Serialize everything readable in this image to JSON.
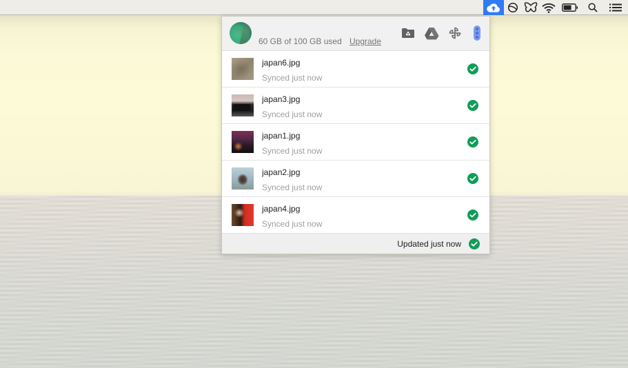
{
  "menubar": {
    "tray_icons": [
      {
        "icon": "google-drive-backup-icon",
        "active": true
      },
      {
        "icon": "circle-slash-icon"
      },
      {
        "icon": "butterfly-icon"
      },
      {
        "icon": "wifi-icon"
      },
      {
        "icon": "battery-icon"
      },
      {
        "icon": "spotlight-search-icon"
      },
      {
        "icon": "notification-center-icon"
      }
    ]
  },
  "panel": {
    "header": {
      "storage_text": "60 GB of 100 GB used",
      "storage_used_gb": 60,
      "storage_total_gb": 100,
      "upgrade_label": "Upgrade",
      "icons": [
        "drive-folder-icon",
        "google-drive-icon",
        "google-photos-icon",
        "more-vert-icon"
      ]
    },
    "files": [
      {
        "name": "japan6.jpg",
        "status": "Synced just now"
      },
      {
        "name": "japan3.jpg",
        "status": "Synced just now"
      },
      {
        "name": "japan1.jpg",
        "status": "Synced just now"
      },
      {
        "name": "japan2.jpg",
        "status": "Synced just now"
      },
      {
        "name": "japan4.jpg",
        "status": "Synced just now"
      }
    ],
    "footer": {
      "status_text": "Updated just now"
    }
  },
  "colors": {
    "accent_blue": "#2f7cf6",
    "success_green": "#0f9d58",
    "more_icon_blue": "#7b9cf0"
  }
}
